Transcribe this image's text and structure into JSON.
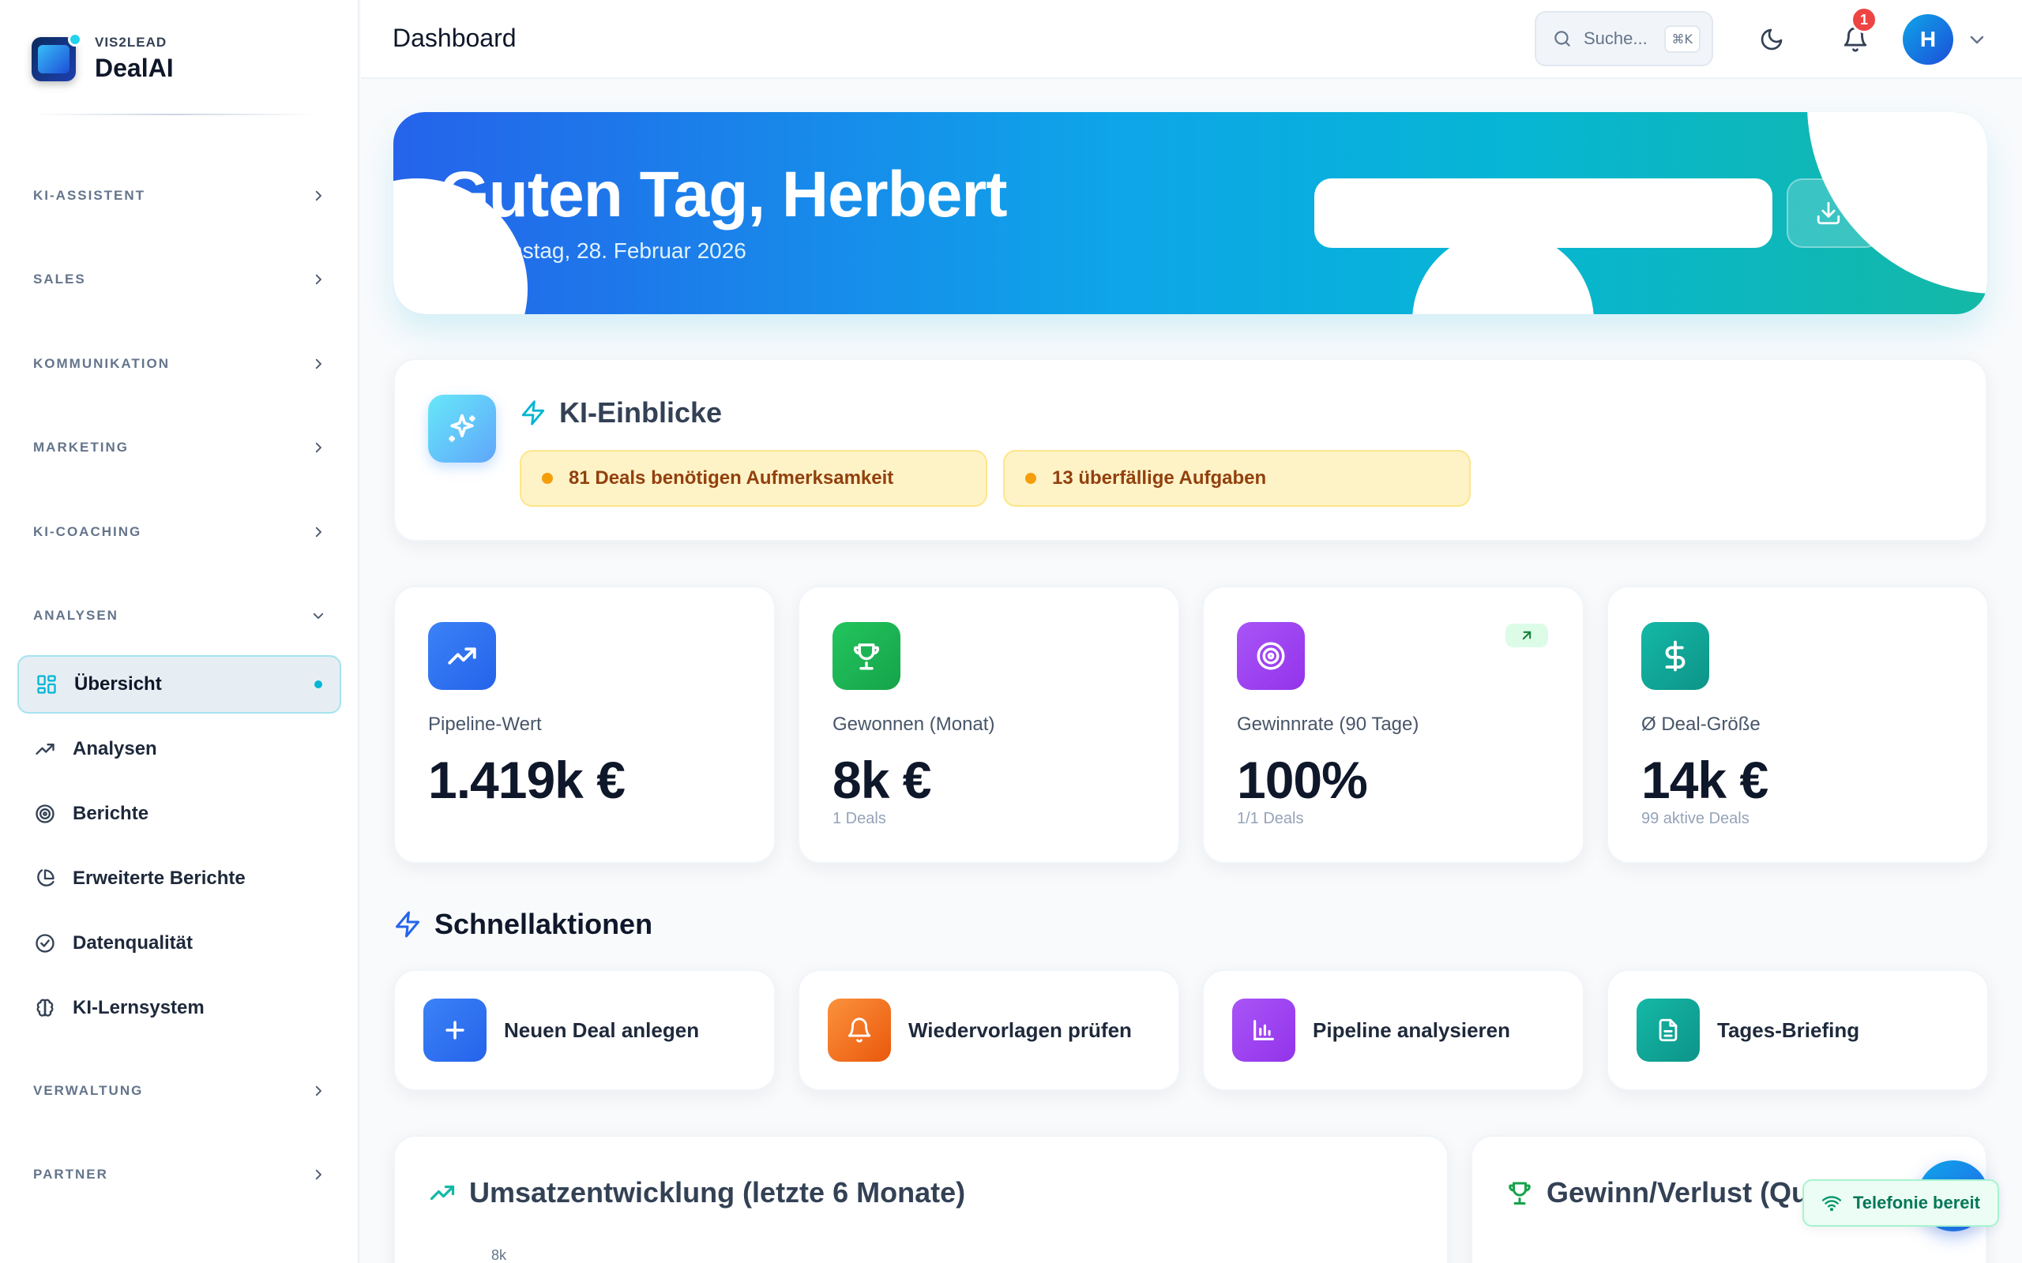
{
  "brand": {
    "sub": "VIS2LEAD",
    "name": "DealAI"
  },
  "sidebar": {
    "sections": [
      {
        "label": "KI-ASSISTENT"
      },
      {
        "label": "SALES"
      },
      {
        "label": "KOMMUNIKATION"
      },
      {
        "label": "MARKETING"
      },
      {
        "label": "KI-COACHING"
      },
      {
        "label": "ANALYSEN"
      },
      {
        "label": "VERWALTUNG"
      },
      {
        "label": "PARTNER"
      }
    ],
    "items": [
      {
        "label": "Übersicht",
        "icon": "grid-icon",
        "active": true
      },
      {
        "label": "Analysen",
        "icon": "trending-up-icon"
      },
      {
        "label": "Berichte",
        "icon": "target-icon"
      },
      {
        "label": "Erweiterte Berichte",
        "icon": "pie-chart-icon"
      },
      {
        "label": "Datenqualität",
        "icon": "check-circle-icon"
      },
      {
        "label": "KI-Lernsystem",
        "icon": "brain-icon"
      }
    ]
  },
  "header": {
    "title": "Dashboard",
    "search_placeholder": "Suche...",
    "search_shortcut": "⌘K",
    "notification_count": "1",
    "avatar_initial": "H"
  },
  "hero": {
    "greeting": "Guten Tag, Herbert",
    "date": "Samstag, 28. Februar 2026"
  },
  "insights": {
    "title": "KI-Einblicke",
    "alerts": [
      "81 Deals benötigen Aufmerksamkeit",
      "13 überfällige Aufgaben"
    ]
  },
  "kpis": [
    {
      "label": "Pipeline-Wert",
      "value": "1.419k €",
      "sub": "",
      "icon": "trending-up-icon",
      "color": "#3b82f6"
    },
    {
      "label": "Gewonnen (Monat)",
      "value": "8k €",
      "sub": "1 Deals",
      "icon": "trophy-icon",
      "color": "#16a34a"
    },
    {
      "label": "Gewinnrate (90 Tage)",
      "value": "100%",
      "sub": "1/1 Deals",
      "icon": "target-icon",
      "color": "#9333ea"
    },
    {
      "label": "Ø Deal-Größe",
      "value": "14k €",
      "sub": "99 aktive Deals",
      "icon": "dollar-icon",
      "color": "#0d9488"
    }
  ],
  "quick_actions": {
    "title": "Schnellaktionen",
    "items": [
      {
        "label": "Neuen Deal anlegen",
        "icon": "plus-icon",
        "color": "#3b82f6"
      },
      {
        "label": "Wiedervorlagen prüfen",
        "icon": "bell-icon",
        "color": "#f97316"
      },
      {
        "label": "Pipeline analysieren",
        "icon": "bar-chart-icon",
        "color": "#9333ea"
      },
      {
        "label": "Tages-Briefing",
        "icon": "document-icon",
        "color": "#0d9488"
      }
    ]
  },
  "revenue": {
    "title": "Umsatzentwicklung (letzte 6 Monate)",
    "y_top_tick": "8k"
  },
  "winloss": {
    "title": "Gewinn/Verlust (Qu"
  },
  "telephony": {
    "label": "Telefonie bereit"
  }
}
